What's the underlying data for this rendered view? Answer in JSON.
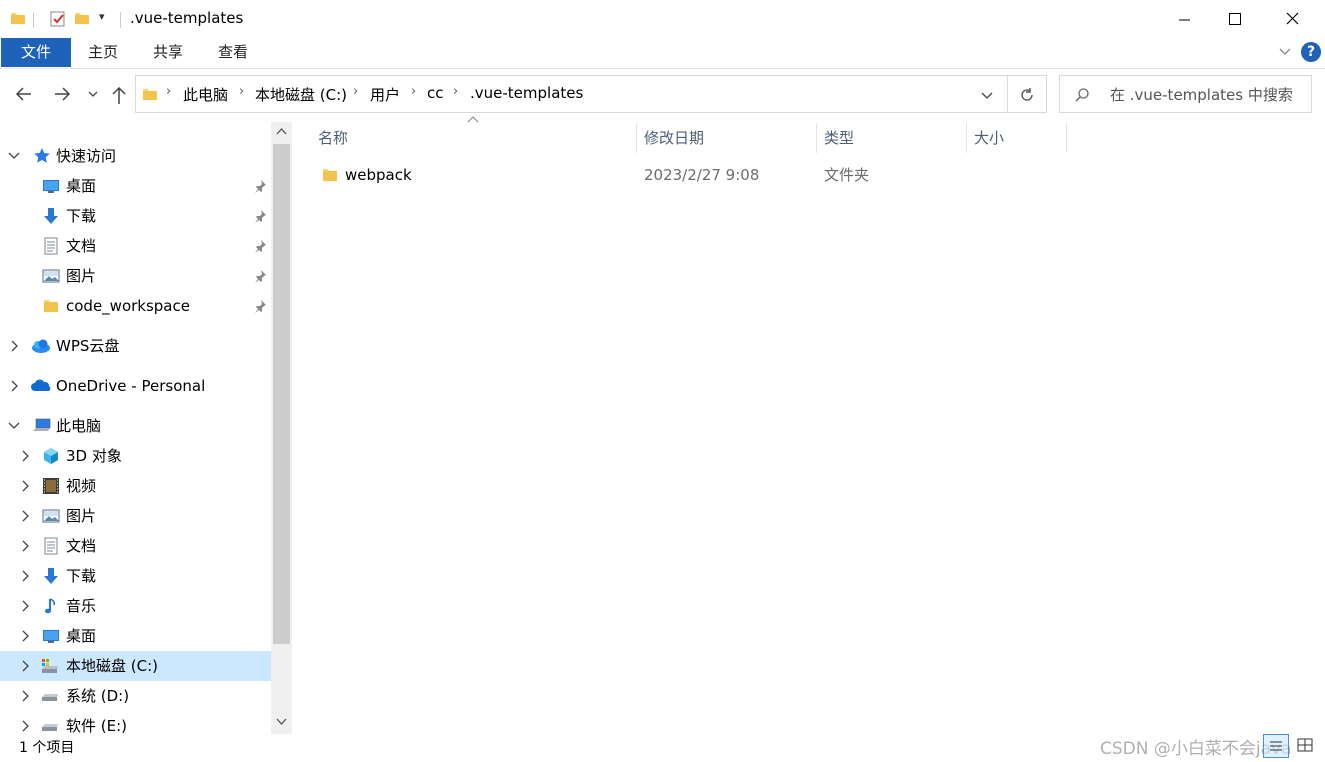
{
  "window": {
    "title": ".vue-templates",
    "controls": {
      "minimize": "minimize-icon",
      "maximize": "maximize-icon",
      "close": "close-icon"
    }
  },
  "ribbon": {
    "tabs": [
      {
        "label": "文件",
        "active": true
      },
      {
        "label": "主页"
      },
      {
        "label": "共享"
      },
      {
        "label": "查看"
      }
    ]
  },
  "nav": {
    "breadcrumb": [
      "此电脑",
      "本地磁盘 (C:)",
      "用户",
      "cc",
      ".vue-templates"
    ],
    "search_placeholder": "在 .vue-templates 中搜索"
  },
  "sidebar": {
    "quick_access": {
      "label": "快速访问",
      "items": [
        {
          "label": "桌面",
          "icon": "desktop-icon"
        },
        {
          "label": "下载",
          "icon": "download-icon"
        },
        {
          "label": "文档",
          "icon": "document-icon"
        },
        {
          "label": "图片",
          "icon": "picture-icon"
        },
        {
          "label": "code_workspace",
          "icon": "folder-icon"
        }
      ]
    },
    "wps": {
      "label": "WPS云盘"
    },
    "onedrive": {
      "label": "OneDrive - Personal"
    },
    "this_pc": {
      "label": "此电脑",
      "items": [
        {
          "label": "3D 对象",
          "icon": "cube-icon"
        },
        {
          "label": "视频",
          "icon": "video-icon"
        },
        {
          "label": "图片",
          "icon": "picture-icon"
        },
        {
          "label": "文档",
          "icon": "document-icon"
        },
        {
          "label": "下载",
          "icon": "download-icon"
        },
        {
          "label": "音乐",
          "icon": "music-icon"
        },
        {
          "label": "桌面",
          "icon": "desktop-icon"
        },
        {
          "label": "本地磁盘 (C:)",
          "icon": "drive-icon",
          "selected": true
        },
        {
          "label": "系统 (D:)",
          "icon": "drive-icon"
        },
        {
          "label": "软件 (E:)",
          "icon": "drive-icon"
        }
      ]
    }
  },
  "columns": {
    "name": "名称",
    "modified": "修改日期",
    "type": "类型",
    "size": "大小"
  },
  "files": [
    {
      "name": "webpack",
      "modified": "2023/2/27 9:08",
      "type": "文件夹",
      "size": ""
    }
  ],
  "status": {
    "count": "1 个项目"
  },
  "watermark": "CSDN @小白菜不会java",
  "colors": {
    "accent": "#1e63b9",
    "selected": "#cce8ff",
    "folder": "#f8d775",
    "header_text": "#4c607a"
  }
}
